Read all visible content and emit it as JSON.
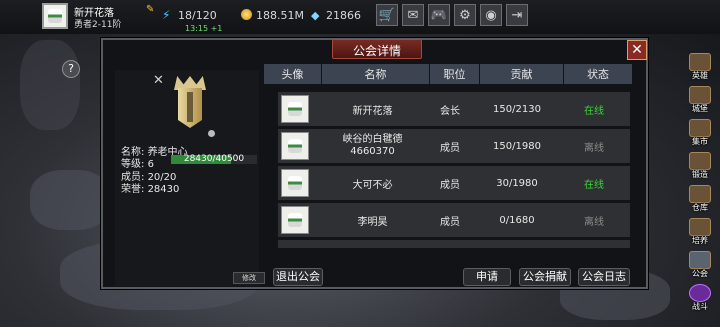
{
  "player": {
    "name": "新开花落",
    "rank": "勇者2-11阶",
    "energy": "18/120",
    "energy_timer": "13:15 +1",
    "gold": "188.51M",
    "gems": "21866"
  },
  "top_icons": [
    "shop-icon",
    "mail-icon",
    "gamepad-icon",
    "gear-icon",
    "color-wheel-icon",
    "exit-icon"
  ],
  "side_menu": [
    {
      "label": "英雄",
      "icon": "hero-icon"
    },
    {
      "label": "城堡",
      "icon": "castle-icon"
    },
    {
      "label": "集市",
      "icon": "market-icon"
    },
    {
      "label": "锻造",
      "icon": "forge-icon"
    },
    {
      "label": "仓库",
      "icon": "warehouse-icon"
    },
    {
      "label": "培养",
      "icon": "train-icon"
    },
    {
      "label": "公会",
      "icon": "guild-icon"
    },
    {
      "label": "战斗",
      "icon": "battle-icon"
    }
  ],
  "dialog": {
    "title": "公会详情",
    "guild": {
      "name_label": "名称:",
      "name": "养老中心",
      "level_label": "等级:",
      "level": "6",
      "exp_text": "28430/40500",
      "exp_fraction": 0.702,
      "members_label": "成员:",
      "members": "20/20",
      "honor_label": "荣誉:",
      "honor": "28430",
      "modify_label": "修改"
    },
    "columns": [
      "头像",
      "名称",
      "职位",
      "贡献",
      "状态"
    ],
    "rows": [
      {
        "name": "新开花落",
        "role": "会长",
        "contribution": "150/2130",
        "status": "在线"
      },
      {
        "name": "峡谷的白毽德\n4660370",
        "role": "成员",
        "contribution": "150/1980",
        "status": "离线"
      },
      {
        "name": "大可不必",
        "role": "成员",
        "contribution": "30/1980",
        "status": "在线"
      },
      {
        "name": "李明昊",
        "role": "成员",
        "contribution": "0/1680",
        "status": "离线"
      }
    ],
    "buttons": {
      "leave": "退出公会",
      "apply": "申请",
      "donate": "公会捐献",
      "log": "公会日志"
    }
  },
  "colors": {
    "online": "#37d437",
    "offline": "#8c8c8c",
    "header_bg": "#3b4450",
    "title_bg": "#7a2a22"
  }
}
